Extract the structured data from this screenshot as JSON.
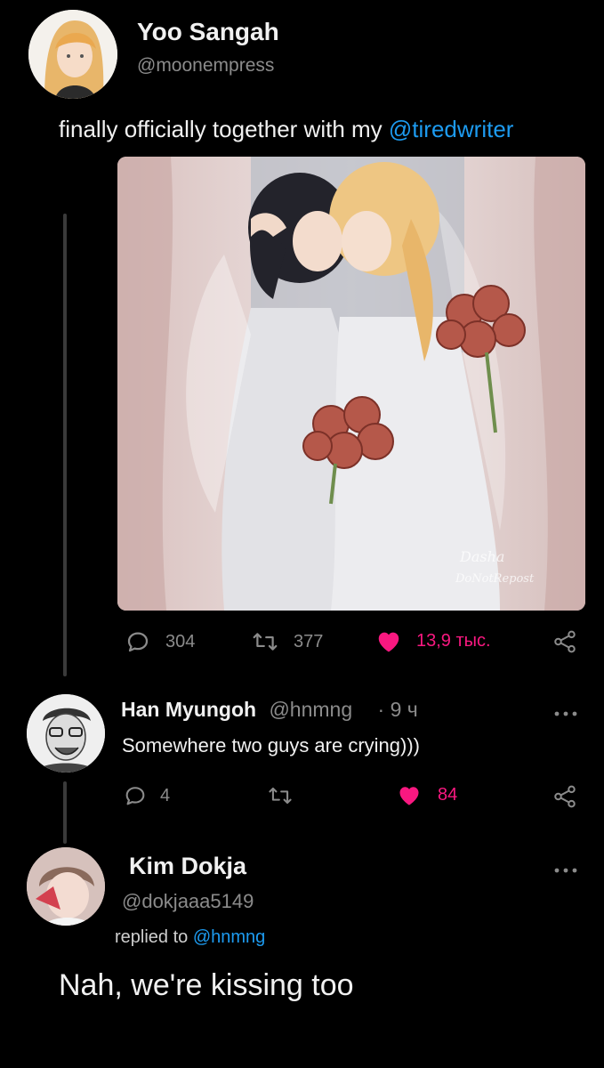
{
  "post": {
    "author_name": "Yoo Sangah",
    "author_handle": "@moonempress",
    "text_before": "finally officially together with my ",
    "mention": "@tiredwriter",
    "stats": {
      "replies": "304",
      "retweets": "377",
      "likes": "13,9 тыс."
    },
    "image_watermark": [
      "Dasha",
      "DoNotRepost"
    ]
  },
  "reply1": {
    "author_name": "Han Myungoh",
    "author_handle": "@hnmng",
    "time": "· 9 ч",
    "text": "Somewhere two guys are crying)))",
    "stats": {
      "replies": "4",
      "retweets": "",
      "likes": "84"
    }
  },
  "reply2": {
    "author_name": "Kim Dokja",
    "author_handle": "@dokjaaa5149",
    "replied_prefix": "replied to ",
    "replied_to": "@hnmng",
    "text": "Nah, we're kissing too"
  },
  "colors": {
    "background": "#000000",
    "text": "#e7e9ea",
    "muted": "#8b8b8b",
    "link": "#1d9bf0",
    "like": "#f91880"
  },
  "icons": [
    "reply-icon",
    "retweet-icon",
    "heart-icon",
    "share-icon",
    "more-icon"
  ]
}
